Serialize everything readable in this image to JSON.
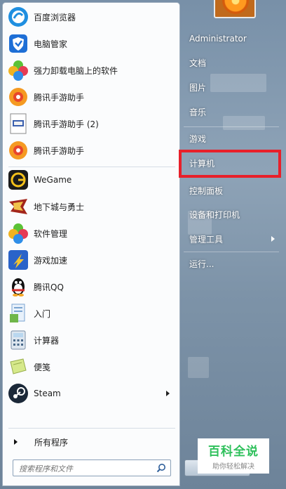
{
  "programs": [
    {
      "label": "百度浏览器",
      "icon": "baidu-browser-icon"
    },
    {
      "label": "电脑管家",
      "icon": "pc-manager-shield-icon"
    },
    {
      "label": "强力卸载电脑上的软件",
      "icon": "uninstall-clover-icon"
    },
    {
      "label": "腾讯手游助手",
      "icon": "tencent-mobile-game-icon"
    },
    {
      "label": "腾讯手游助手 (2)",
      "icon": "document-exe-icon"
    },
    {
      "label": "腾讯手游助手",
      "icon": "tencent-mobile-game-icon"
    },
    {
      "label": "WeGame",
      "icon": "wegame-icon"
    },
    {
      "label": "地下城与勇士",
      "icon": "dnf-game-icon"
    },
    {
      "label": "软件管理",
      "icon": "software-manager-icon"
    },
    {
      "label": "游戏加速",
      "icon": "game-accelerator-icon"
    },
    {
      "label": "腾讯QQ",
      "icon": "qq-penguin-icon"
    },
    {
      "label": "入门",
      "icon": "getting-started-icon"
    },
    {
      "label": "计算器",
      "icon": "calculator-icon"
    },
    {
      "label": "便笺",
      "icon": "sticky-notes-icon"
    },
    {
      "label": "Steam",
      "icon": "steam-icon"
    }
  ],
  "all_programs": "所有程序",
  "search": {
    "placeholder": "搜索程序和文件"
  },
  "right_menu": [
    {
      "label": "Administrator"
    },
    {
      "label": "文档"
    },
    {
      "label": "图片"
    },
    {
      "label": "音乐"
    },
    {
      "label": "游戏"
    },
    {
      "label": "计算机"
    },
    {
      "label": "控制面板"
    },
    {
      "label": "设备和打印机"
    },
    {
      "label": "管理工具"
    },
    {
      "label": "运行..."
    }
  ],
  "watermark": {
    "title": "百科全说",
    "subtitle": "助你轻松解决"
  },
  "colors": {
    "highlight": "#e8202a",
    "watermark_green": "#2ec05b"
  }
}
